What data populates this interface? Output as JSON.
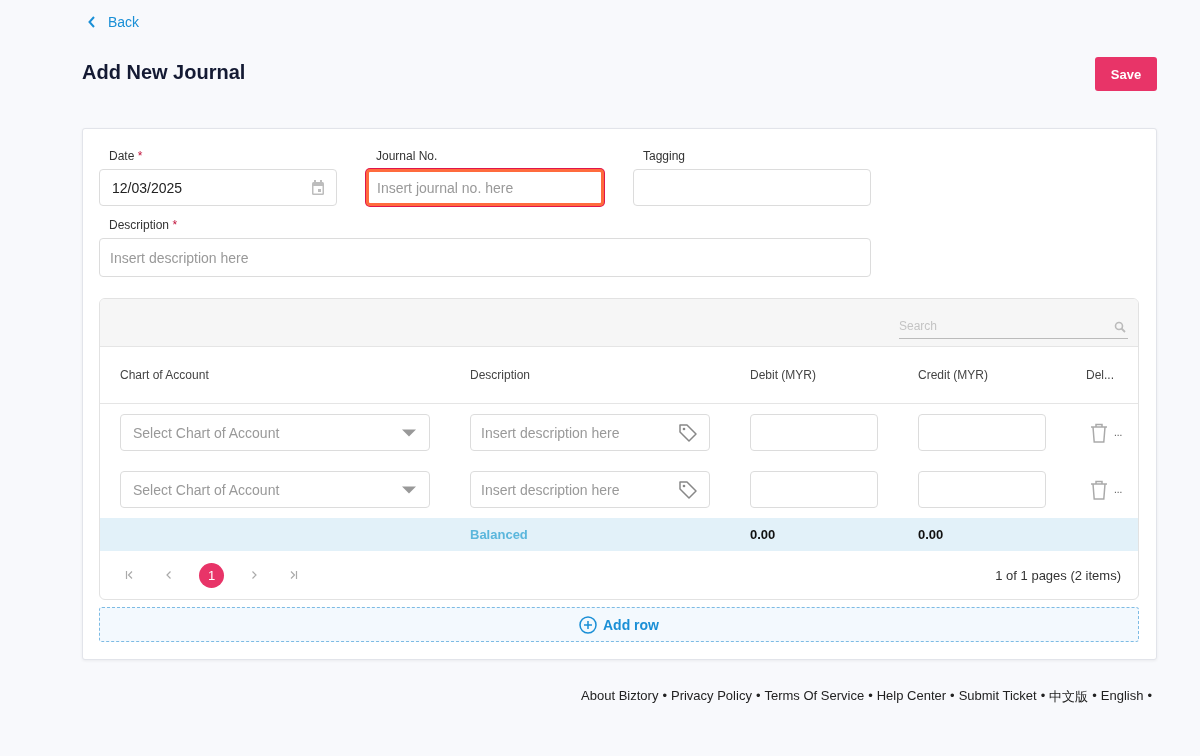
{
  "back_link": "Back",
  "title": "Add New Journal",
  "save_button": "Save",
  "form": {
    "fields": [
      {
        "label": "Date",
        "required_mark": "*",
        "value": "12/03/2025",
        "kind": "date",
        "focused": false
      },
      {
        "label": "Journal No.",
        "placeholder": "Insert journal no. here",
        "kind": "text",
        "focused": true
      },
      {
        "label": "Tagging",
        "kind": "text",
        "focused": false
      }
    ],
    "description": {
      "label": "Description",
      "required_mark": "*",
      "placeholder": "Insert description here"
    }
  },
  "table": {
    "search": {
      "placeholder": "Search"
    },
    "columns": [
      "Chart of Account",
      "Description",
      "Debit (MYR)",
      "Credit (MYR)",
      "Del..."
    ],
    "rows": [
      {
        "account_placeholder": "Select Chart of Account",
        "description_placeholder": "Insert description here",
        "more": "..."
      },
      {
        "account_placeholder": "Select Chart of Account",
        "description_placeholder": "Insert description here",
        "more": "..."
      }
    ],
    "summary": {
      "status": "Balanced",
      "debit": "0.00",
      "credit": "0.00"
    },
    "pagination": {
      "pages": [
        {
          "label": "1",
          "selected": true
        }
      ],
      "info": "1 of 1 pages (2 items)"
    }
  },
  "add_row": "Add row",
  "footer_links": [
    {
      "label": "About Biztory",
      "separator": "•"
    },
    {
      "label": "Privacy Policy",
      "separator": "•"
    },
    {
      "label": "Terms Of Service",
      "separator": "•"
    },
    {
      "label": "Help Center",
      "separator": "•"
    },
    {
      "label": "Submit Ticket",
      "separator": "•"
    },
    {
      "label": "中文版",
      "separator": "•"
    },
    {
      "label": "English",
      "separator": "•"
    }
  ]
}
